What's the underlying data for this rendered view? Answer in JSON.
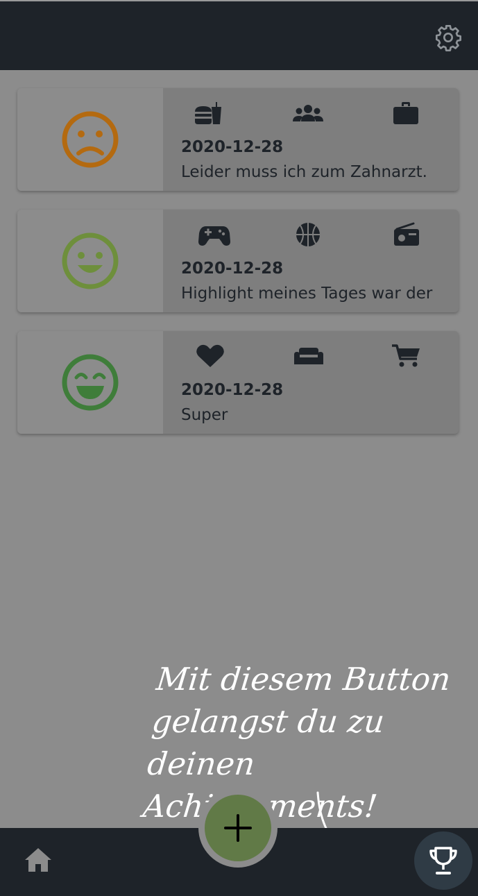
{
  "colors": {
    "background": "#8c8c8c",
    "bar": "#1e2329",
    "card": "#7e7e7e",
    "sad": "#b46a10",
    "happy": "#6e8f3c",
    "very_happy": "#3f7d3a",
    "fab": "#617a47"
  },
  "header": {
    "settings_icon": "gear-icon"
  },
  "entries": [
    {
      "mood_icon": "frown-icon",
      "categories": [
        "burger-soda-icon",
        "group-icon",
        "briefcase-icon"
      ],
      "date": "2020-12-28",
      "text": "Leider muss ich zum Zahnarzt."
    },
    {
      "mood_icon": "smile-icon",
      "categories": [
        "gamepad-icon",
        "basketball-icon",
        "radio-icon"
      ],
      "date": "2020-12-28",
      "text": "Highlight meines Tages war der"
    },
    {
      "mood_icon": "grin-beam-icon",
      "categories": [
        "heart-icon",
        "couch-icon",
        "cart-icon"
      ],
      "date": "2020-12-28",
      "text": "Super"
    }
  ],
  "tutorial": {
    "line1": "Mit diesem Button",
    "line2": "gelangst du zu deinen",
    "line3": "Achievements!"
  },
  "bottom_nav": {
    "home_icon": "home-icon",
    "add_icon": "plus-icon",
    "achievements_icon": "trophy-icon"
  }
}
